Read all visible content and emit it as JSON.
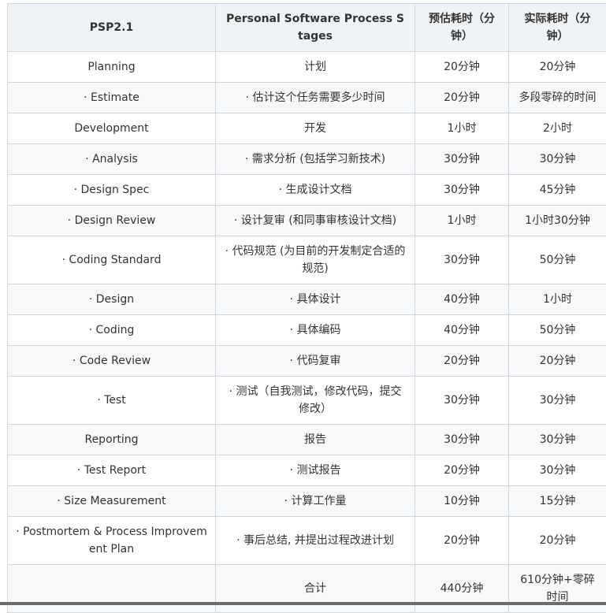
{
  "table": {
    "headers": {
      "psp": "PSP2.1",
      "stages": "Personal Software Process Stages",
      "estimated": "预估耗时（分钟）",
      "actual": "实际耗时（分钟）"
    },
    "rows": [
      {
        "psp": "Planning",
        "stage": "计划",
        "estimated": "20分钟",
        "actual": "20分钟"
      },
      {
        "psp": "· Estimate",
        "stage": "· 估计这个任务需要多少时间",
        "estimated": "20分钟",
        "actual": "多段零碎的时间"
      },
      {
        "psp": "Development",
        "stage": "开发",
        "estimated": "1小时",
        "actual": "2小时"
      },
      {
        "psp": "· Analysis",
        "stage": "· 需求分析 (包括学习新技术)",
        "estimated": "30分钟",
        "actual": "30分钟"
      },
      {
        "psp": "· Design Spec",
        "stage": "· 生成设计文档",
        "estimated": "30分钟",
        "actual": "45分钟"
      },
      {
        "psp": "· Design Review",
        "stage": "· 设计复审 (和同事审核设计文档)",
        "estimated": "1小时",
        "actual": "1小时30分钟"
      },
      {
        "psp": "· Coding Standard",
        "stage": "· 代码规范 (为目前的开发制定合适的规范)",
        "estimated": "30分钟",
        "actual": "50分钟"
      },
      {
        "psp": "· Design",
        "stage": "· 具体设计",
        "estimated": "40分钟",
        "actual": "1小时"
      },
      {
        "psp": "· Coding",
        "stage": "· 具体编码",
        "estimated": "40分钟",
        "actual": "50分钟"
      },
      {
        "psp": "· Code Review",
        "stage": "· 代码复审",
        "estimated": "20分钟",
        "actual": "20分钟"
      },
      {
        "psp": "· Test",
        "stage": "· 测试（自我测试，修改代码，提交修改）",
        "estimated": "30分钟",
        "actual": "30分钟"
      },
      {
        "psp": "Reporting",
        "stage": "报告",
        "estimated": "30分钟",
        "actual": "30分钟"
      },
      {
        "psp": "· Test Report",
        "stage": "· 测试报告",
        "estimated": "20分钟",
        "actual": "30分钟"
      },
      {
        "psp": "· Size Measurement",
        "stage": "· 计算工作量",
        "estimated": "10分钟",
        "actual": "15分钟"
      },
      {
        "psp": "· Postmortem & Process Improvement Plan",
        "stage": "· 事后总结, 并提出过程改进计划",
        "estimated": "20分钟",
        "actual": "20分钟"
      },
      {
        "psp": "",
        "stage": "合计",
        "estimated": "440分钟",
        "actual": "610分钟+零碎时间"
      }
    ]
  }
}
